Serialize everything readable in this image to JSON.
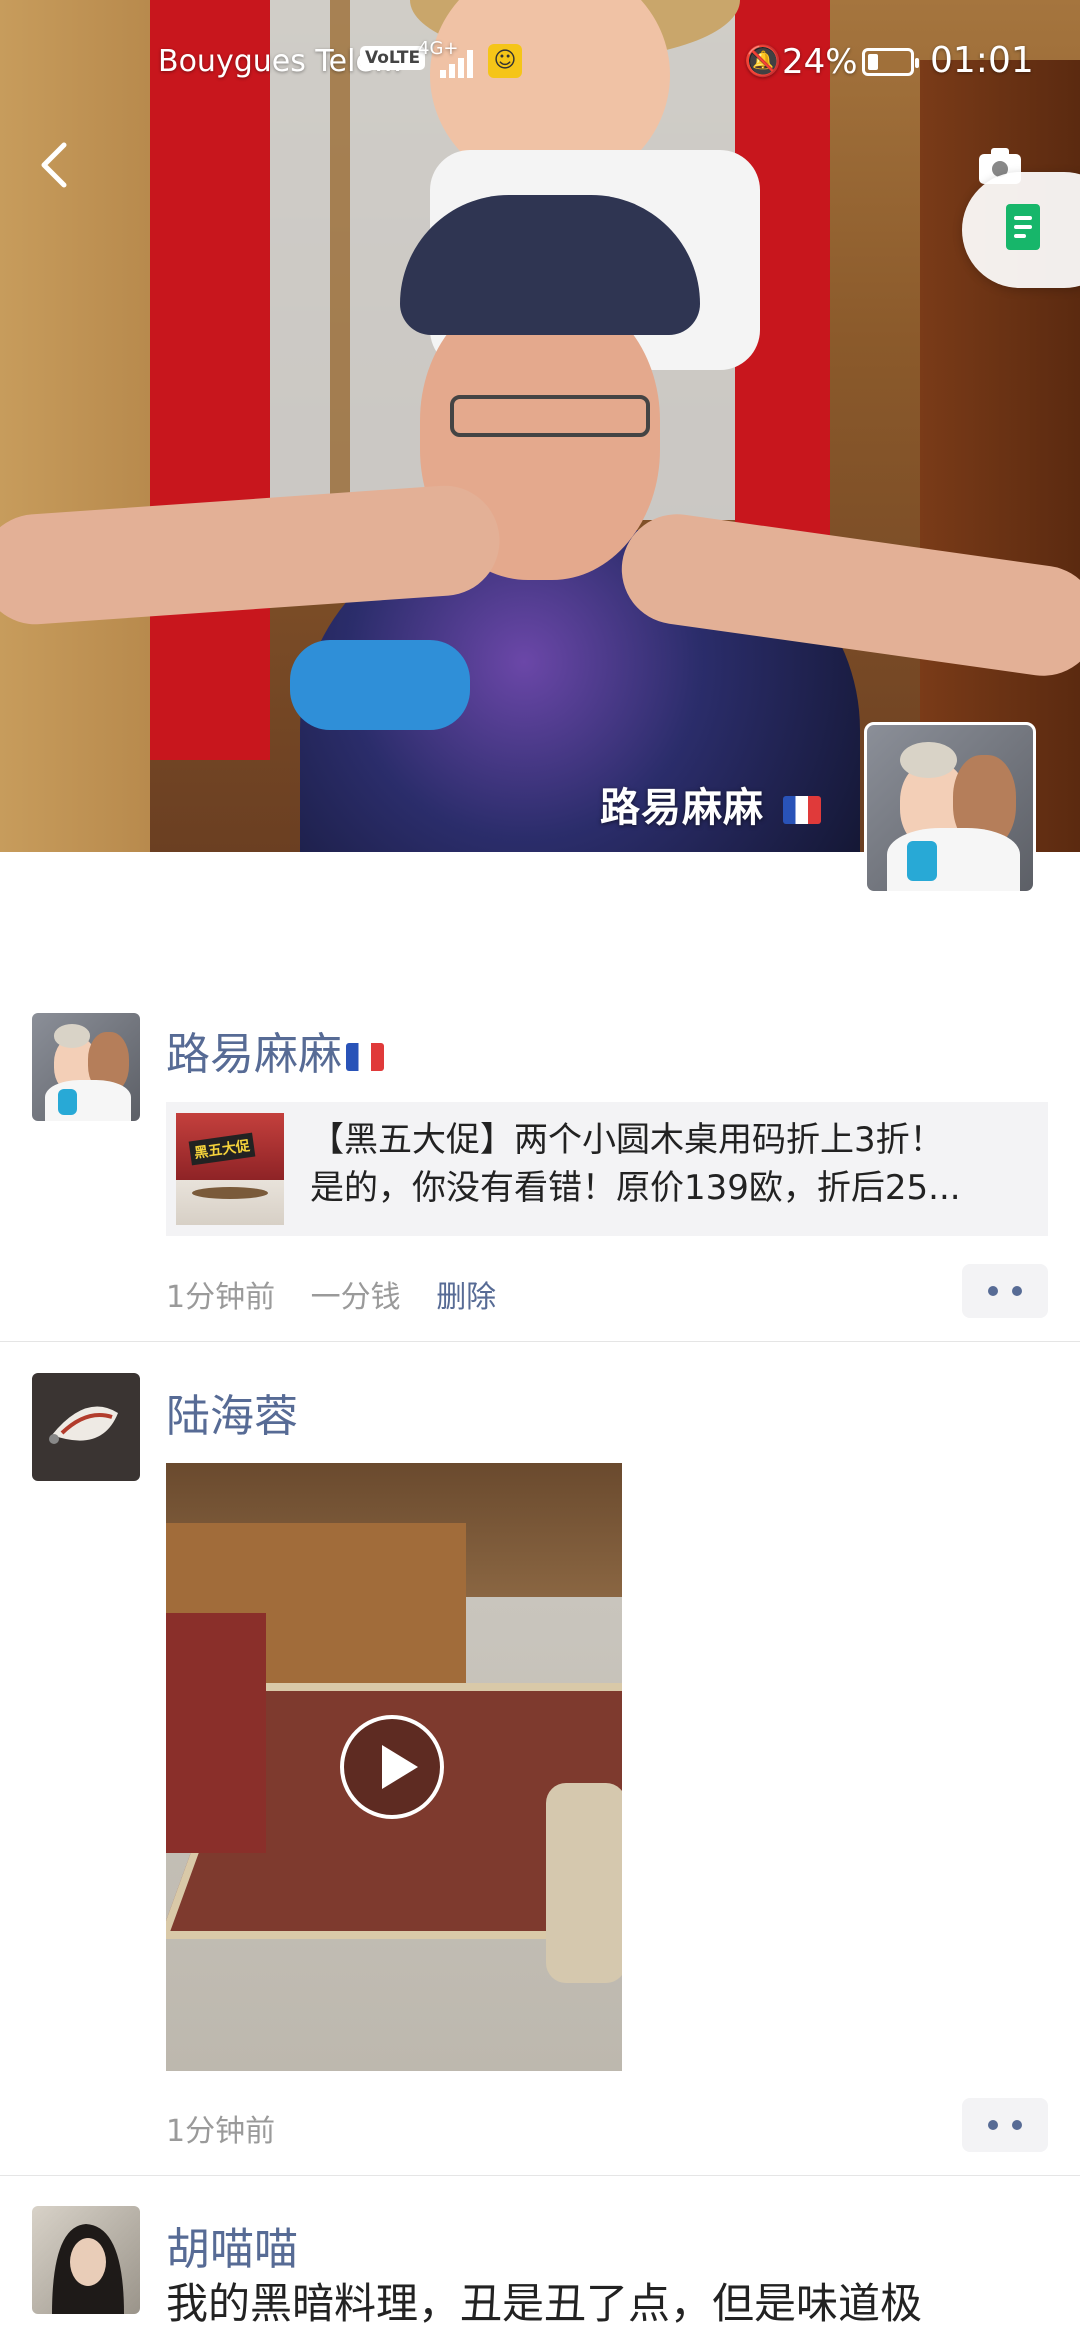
{
  "status_bar": {
    "carrier": "Bouygues Tele...",
    "volte": "VoLTE",
    "network": "4G+",
    "battery_percent": "24%",
    "battery_level": 0.24,
    "time": "01:01"
  },
  "cover": {
    "name": "路易麻麻",
    "flag_icon": "france-flag-icon"
  },
  "feed": {
    "posts": [
      {
        "nickname": "路易麻麻",
        "link_card": {
          "line1": "【黑五大促】两个小圆木桌用码折上3折！",
          "line2": "是的，你没有看错！原价139欧，折后25...",
          "thumb_tag": "黑五大促"
        },
        "time": "1分钟前",
        "source": "一分钱",
        "delete_label": "删除"
      },
      {
        "nickname": "陆海蓉",
        "time": "1分钟前"
      },
      {
        "nickname": "胡喵喵",
        "text": "我的黑暗料理，丑是丑了点，但是味道极"
      }
    ]
  },
  "colors": {
    "link_blue": "#576b95",
    "meta_gray": "#9a9a9a",
    "card_bg": "#f3f3f5"
  }
}
